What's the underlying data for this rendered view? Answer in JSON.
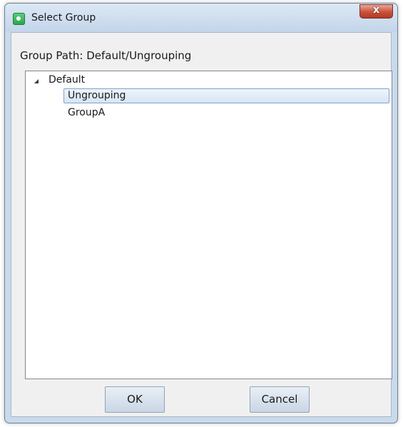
{
  "window": {
    "title": "Select Group",
    "close_label": "x"
  },
  "group_path": "Group Path: Default/Ungrouping",
  "tree": {
    "root": {
      "label": "Default",
      "expanded": true,
      "children": [
        {
          "label": "Ungrouping",
          "selected": true
        },
        {
          "label": "GroupA",
          "selected": false
        }
      ]
    }
  },
  "buttons": {
    "ok_label": "OK",
    "cancel_label": "Cancel"
  },
  "icons": {
    "app": "app-icon",
    "close": "close-icon",
    "expander": "expanded-triangle-icon"
  },
  "colors": {
    "title_bar": "#c9daed",
    "close_button": "#c9503a",
    "selection_border": "#7da2ce",
    "selection_fill": "#dde9f7"
  }
}
